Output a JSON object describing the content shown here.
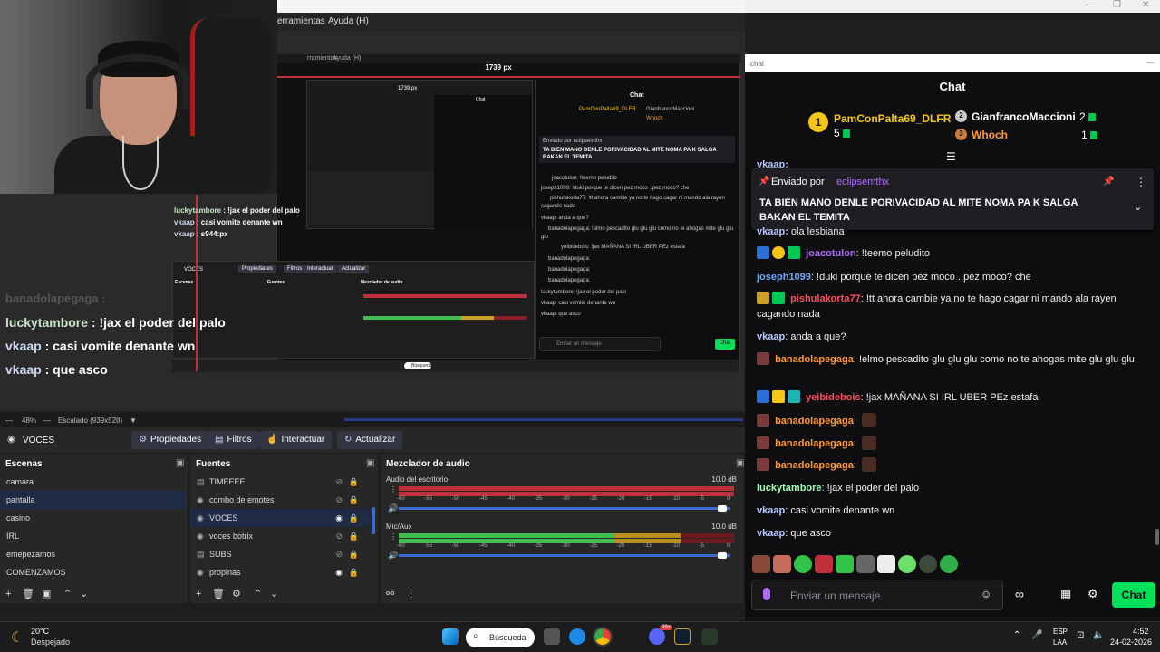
{
  "menu": {
    "item1": "erramientas",
    "item2": "Ayuda (H)"
  },
  "nested": {
    "menu1": "rramientas",
    "menu2": "Ayuda (H)",
    "width_label": "1739 px",
    "chat_title": "Chat",
    "chat_lines": [
      "PamConPalta69_DLFR",
      "GianfrancoMaccioni",
      "Whoch",
      "Enviado por eclipsemthx",
      "TA BIEN MANO DENLE PORIVACIDAD AL MITE NOMA PA K SALGA",
      "BAKAN EL TEMITA",
      "joacotulon: !teemo peludito",
      "joseph1099: !duki porque te dicen pez moco ..pez moco? che",
      "pishulakorta77: !tt ahora cambie ya no te hago cagar ni mando ala rayen",
      "cagando nada",
      "vkaap: anda a que?",
      "banadolapegaga: !elmo pescadito glu glu glu como no te ahogas mite glu glu",
      "glu",
      "yeibidebois: !jax MAÑANA SI IRL UBER PEz estafa",
      "banadolapegaga:",
      "banadolapegaga:",
      "banadolapegaga:",
      "luckytambore: !jax el poder del palo",
      "vkaap: casi vomite denante wn",
      "vkaap: que asco"
    ],
    "input_placeholder": "Enviar un mensaje",
    "send": "Chat",
    "obs_source": "VOCES",
    "obs_buttons": [
      "Propiedades",
      "Filtros",
      "Interactuar",
      "Actualizar"
    ],
    "obs_scenes_title": "Escenas",
    "obs_sources_title": "Fuentes",
    "obs_mixer_title": "Mezclador de audio",
    "obs_scenes": [
      "camara",
      "pantalla",
      "casino",
      "IRL",
      "COMENZAMOS"
    ],
    "obs_sources": [
      "TIMEEEE",
      "combo de emotes",
      "VOCES",
      "voces botrix",
      "SUBS",
      "propinas"
    ],
    "search": "Búsqueda"
  },
  "overlay_small": [
    {
      "name": "luckytambore",
      "text": " : !jax el poder del palo"
    },
    {
      "name": "vkaap",
      "text": " : casi vomite denante wn"
    },
    {
      "name": "vkaap",
      "text": " : s944:px"
    }
  ],
  "overlay_chat": [
    {
      "name": "banadolapegaga",
      "text": " : ",
      "faded": true
    },
    {
      "name": "luckytambore",
      "text": " : !jax el poder del palo",
      "faded": false
    },
    {
      "name": "vkaap",
      "text": " : casi vomite denante wn",
      "faded": false
    },
    {
      "name": "vkaap",
      "text": " : que asco",
      "faded": false
    }
  ],
  "status": {
    "zoom": "48%",
    "scale": "Escalado (939x528)"
  },
  "source_toolbar": {
    "source_name": "VOCES",
    "buttons": [
      "Propiedades",
      "Filtros",
      "Interactuar",
      "Actualizar"
    ]
  },
  "scenes": {
    "title": "Escenas",
    "items": [
      "camara",
      "pantalla",
      "casino",
      "IRL",
      "emepezamos",
      "COMENZAMOS"
    ],
    "selected": "pantalla"
  },
  "sources": {
    "title": "Fuentes",
    "items": [
      {
        "name": "TIMEEEE",
        "visible": false
      },
      {
        "name": "combo de emotes",
        "visible": false
      },
      {
        "name": "VOCES",
        "visible": true
      },
      {
        "name": "voces botrix",
        "visible": false
      },
      {
        "name": "SUBS",
        "visible": false
      },
      {
        "name": "propinas",
        "visible": true
      }
    ],
    "selected": "VOCES"
  },
  "mixer": {
    "title": "Mezclador de audio",
    "channels": [
      {
        "name": "Audio del escritorio",
        "db": "10.0 dB",
        "level": 0.0
      },
      {
        "name": "Mic/Aux",
        "db": "10.0 dB",
        "level": 0.52
      }
    ],
    "scale": [
      "-60",
      "-55",
      "-50",
      "-45",
      "-40",
      "-35",
      "-30",
      "-25",
      "-20",
      "-15",
      "-10",
      "-5",
      "0"
    ]
  },
  "chat": {
    "url_label": "chat",
    "title": "Chat",
    "leaderboard": [
      {
        "rank": "1",
        "name": "PamConPalta69_DLFR",
        "count": "5",
        "color": "#f5c518"
      },
      {
        "rank": "2",
        "name": "GianfrancoMaccioni",
        "count": "2",
        "color": "#c9c9c9"
      },
      {
        "rank": "3",
        "name": "Whoch",
        "count": "1",
        "color": "#c87b3c"
      }
    ],
    "pin": {
      "sent_by_label": "Enviado por",
      "sent_by_user": "eclipsemthx",
      "text": "TA BIEN MANO DENLE PORIVACIDAD AL MITE NOMA PA K SALGA BAKAN EL TEMITA"
    },
    "partial_top": "vkaap:",
    "partial_hidden": "ola lesbiana",
    "messages": [
      {
        "user": "joacotulon",
        "color": "#b16bff",
        "text": "!teemo peludito"
      },
      {
        "user": "joseph1099",
        "color": "#6fa8ff",
        "text": "!duki porque te dicen pez moco ..pez moco? che"
      },
      {
        "user": "pishulakorta77",
        "color": "#ff4b5c",
        "text": "!tt ahora cambie ya no te hago cagar ni mando ala rayen cagando nada"
      },
      {
        "user": "vkaap",
        "color": "#b9c8ff",
        "text": "anda a que?"
      },
      {
        "user": "banadolapegaga",
        "color": "#ff9a3c",
        "text": "!elmo pescadito glu glu glu como no te ahogas mite glu glu glu"
      },
      {
        "user": "yeibidebois",
        "color": "#ff4b5c",
        "text": "!jax MAÑANA SI IRL UBER PEz estafa"
      },
      {
        "user": "banadolapegaga",
        "color": "#ff9a3c",
        "text": ""
      },
      {
        "user": "banadolapegaga",
        "color": "#ff9a3c",
        "text": ""
      },
      {
        "user": "banadolapegaga",
        "color": "#ff9a3c",
        "text": ""
      },
      {
        "user": "luckytambore",
        "color": "#9fffb8",
        "text": "!jax el poder del palo"
      },
      {
        "user": "vkaap",
        "color": "#b9c8ff",
        "text": "casi vomite denante wn"
      },
      {
        "user": "vkaap",
        "color": "#b9c8ff",
        "text": "que asco"
      }
    ],
    "input_placeholder": "Enviar un mensaje",
    "send_label": "Chat"
  },
  "taskbar": {
    "weather_temp": "20°C",
    "weather_desc": "Despejado",
    "search_label": "Búsqueda",
    "lang": "ESP",
    "lang_sub": "LAA",
    "time": "4:52",
    "date": "24-02-2026",
    "discord_badge": "99+"
  }
}
